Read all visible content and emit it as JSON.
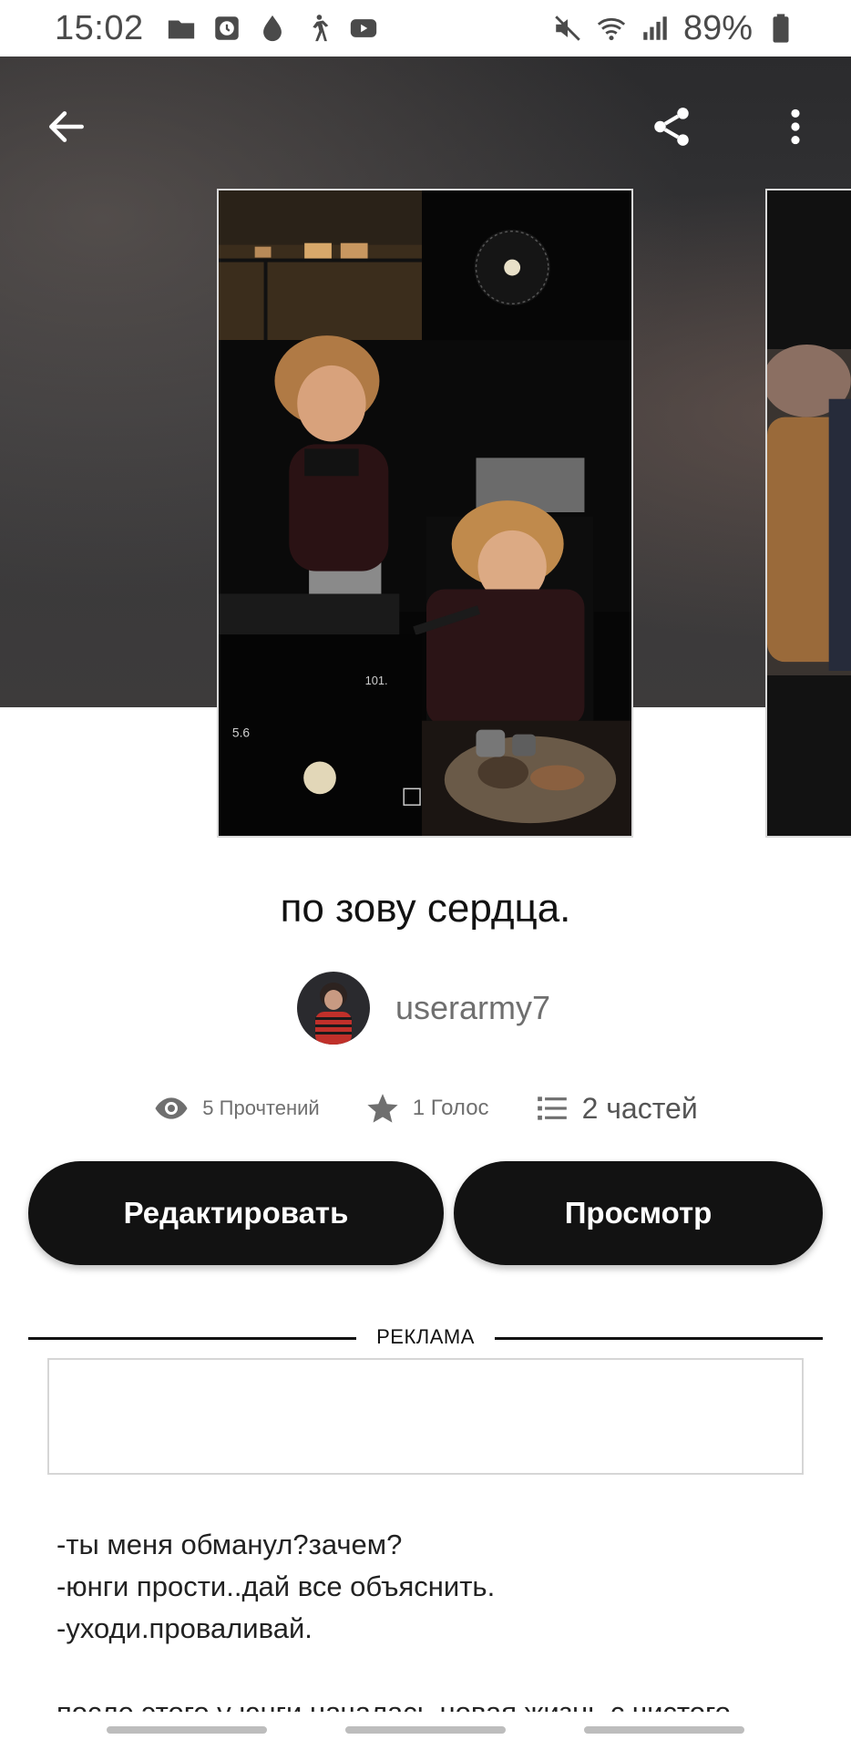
{
  "status_bar": {
    "time": "15:02",
    "battery": "89%",
    "left_icons": [
      "folder-icon",
      "clock-icon",
      "drop-icon",
      "walking-icon",
      "youtube-icon"
    ],
    "right_icons": [
      "mute-icon",
      "wifi-icon",
      "signal-icon",
      "battery-icon"
    ]
  },
  "header": {
    "back_icon": "arrow-left-icon",
    "share_icon": "share-icon",
    "more_icon": "more-vertical-icon"
  },
  "book": {
    "title": "по зову сердца.",
    "author": "userarmy7"
  },
  "stats": {
    "reads": "5 Прочтений",
    "votes": "1 Голос",
    "parts": "2 частей"
  },
  "actions": {
    "edit_label": "Редактировать",
    "view_label": "Просмотр"
  },
  "ad": {
    "label": "РЕКЛАМА"
  },
  "story": {
    "lines": [
      "-ты меня обманул?зачем?",
      "-юнги прости..дай все объяснить.",
      "-уходи.проваливай.",
      "после этого у юнги началась новая жизнь с чистого"
    ]
  },
  "colors": {
    "button_bg": "#121212",
    "button_text": "#ffffff",
    "muted_text": "#6f6f6f",
    "hero_bg": "#333335"
  }
}
